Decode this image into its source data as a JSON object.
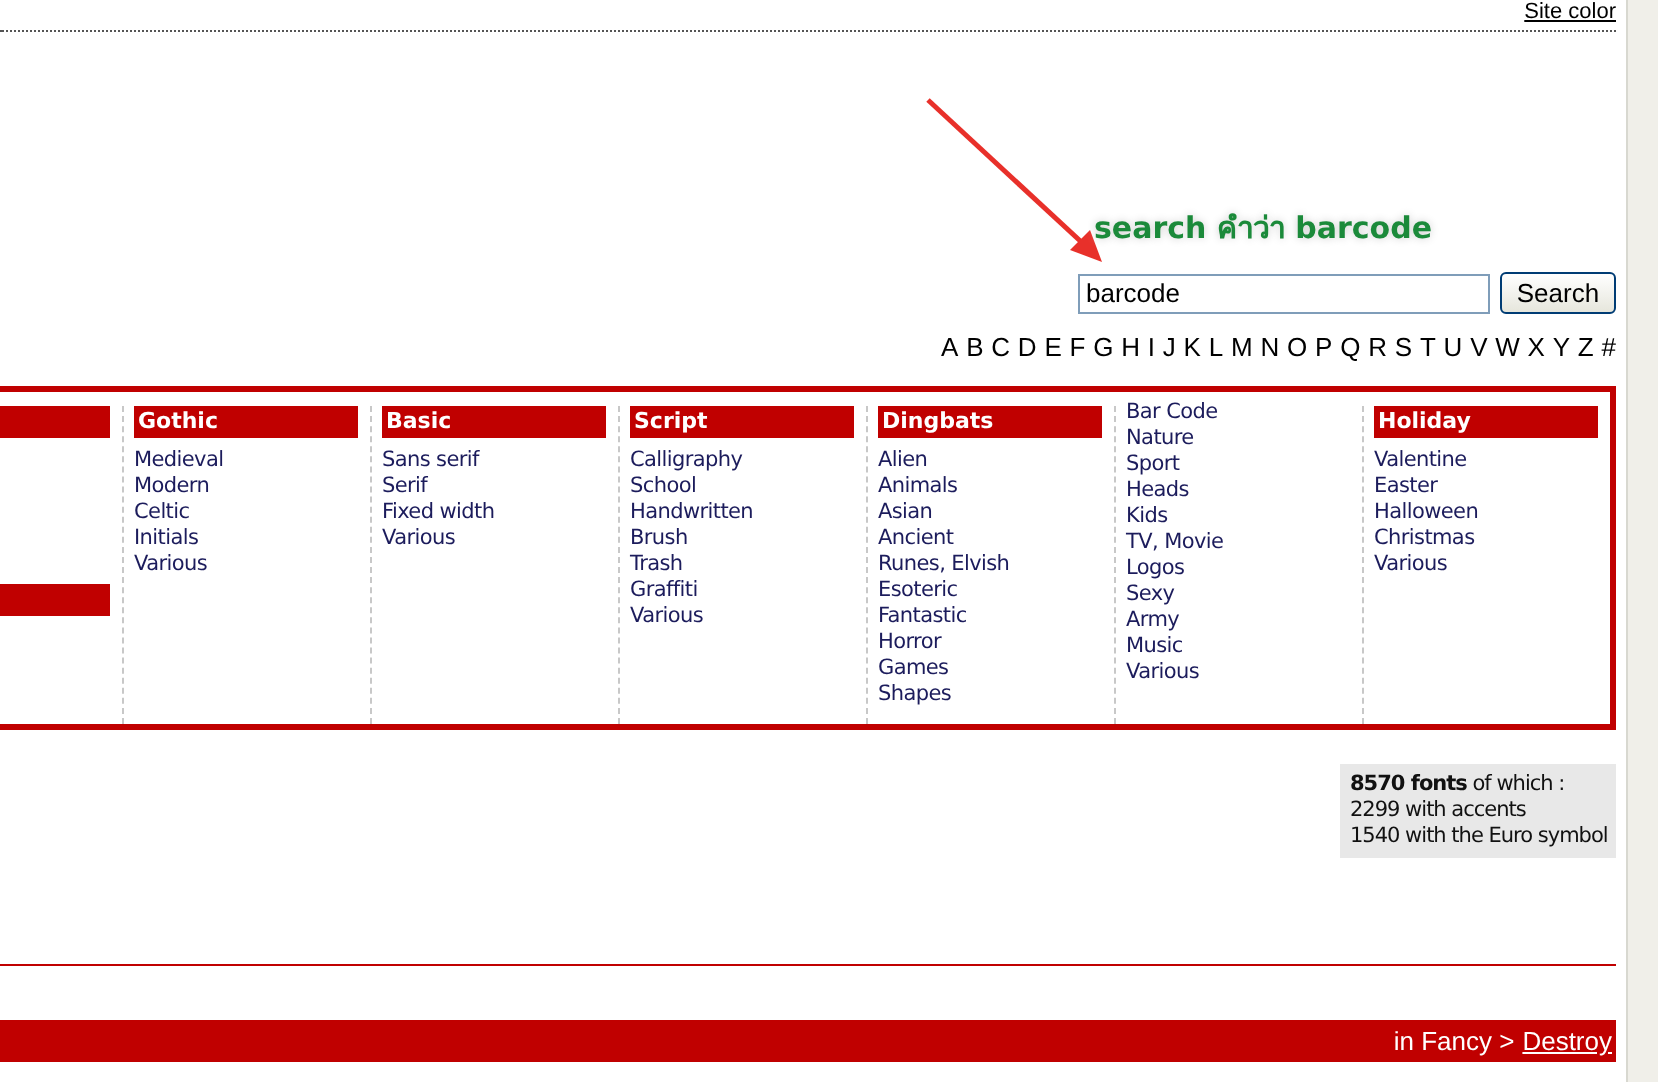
{
  "top_link": "Site color",
  "annotation": {
    "text": "search คำว่า barcode"
  },
  "search": {
    "value": "barcode",
    "button": "Search"
  },
  "alphabet": [
    "A",
    "B",
    "C",
    "D",
    "E",
    "F",
    "G",
    "H",
    "I",
    "J",
    "K",
    "L",
    "M",
    "N",
    "O",
    "P",
    "Q",
    "R",
    "S",
    "T",
    "U",
    "V",
    "W",
    "X",
    "Y",
    "Z",
    "#"
  ],
  "categories": [
    {
      "kind": "clipped"
    },
    {
      "kind": "group",
      "title": "Gothic",
      "items": [
        "Medieval",
        "Modern",
        "Celtic",
        "Initials",
        "Various"
      ]
    },
    {
      "kind": "group",
      "title": "Basic",
      "items": [
        "Sans serif",
        "Serif",
        "Fixed width",
        "Various"
      ]
    },
    {
      "kind": "group",
      "title": "Script",
      "items": [
        "Calligraphy",
        "School",
        "Handwritten",
        "Brush",
        "Trash",
        "Graffiti",
        "Various"
      ]
    },
    {
      "kind": "group",
      "title": "Dingbats",
      "items": [
        "Alien",
        "Animals",
        "Asian",
        "Ancient",
        "Runes, Elvish",
        "Esoteric",
        "Fantastic",
        "Horror",
        "Games",
        "Shapes"
      ]
    },
    {
      "kind": "list",
      "items": [
        "Bar Code",
        "Nature",
        "Sport",
        "Heads",
        "Kids",
        "TV, Movie",
        "Logos",
        "Sexy",
        "Army",
        "Music",
        "Various"
      ]
    },
    {
      "kind": "group",
      "title": "Holiday",
      "items": [
        "Valentine",
        "Easter",
        "Halloween",
        "Christmas",
        "Various"
      ]
    }
  ],
  "stats": [
    "**8570 fonts** of which :",
    "2299 with accents",
    "1540 with the Euro symbol"
  ],
  "breadcrumb": {
    "prefix": "in Fancy >",
    "link": "Destroy"
  }
}
